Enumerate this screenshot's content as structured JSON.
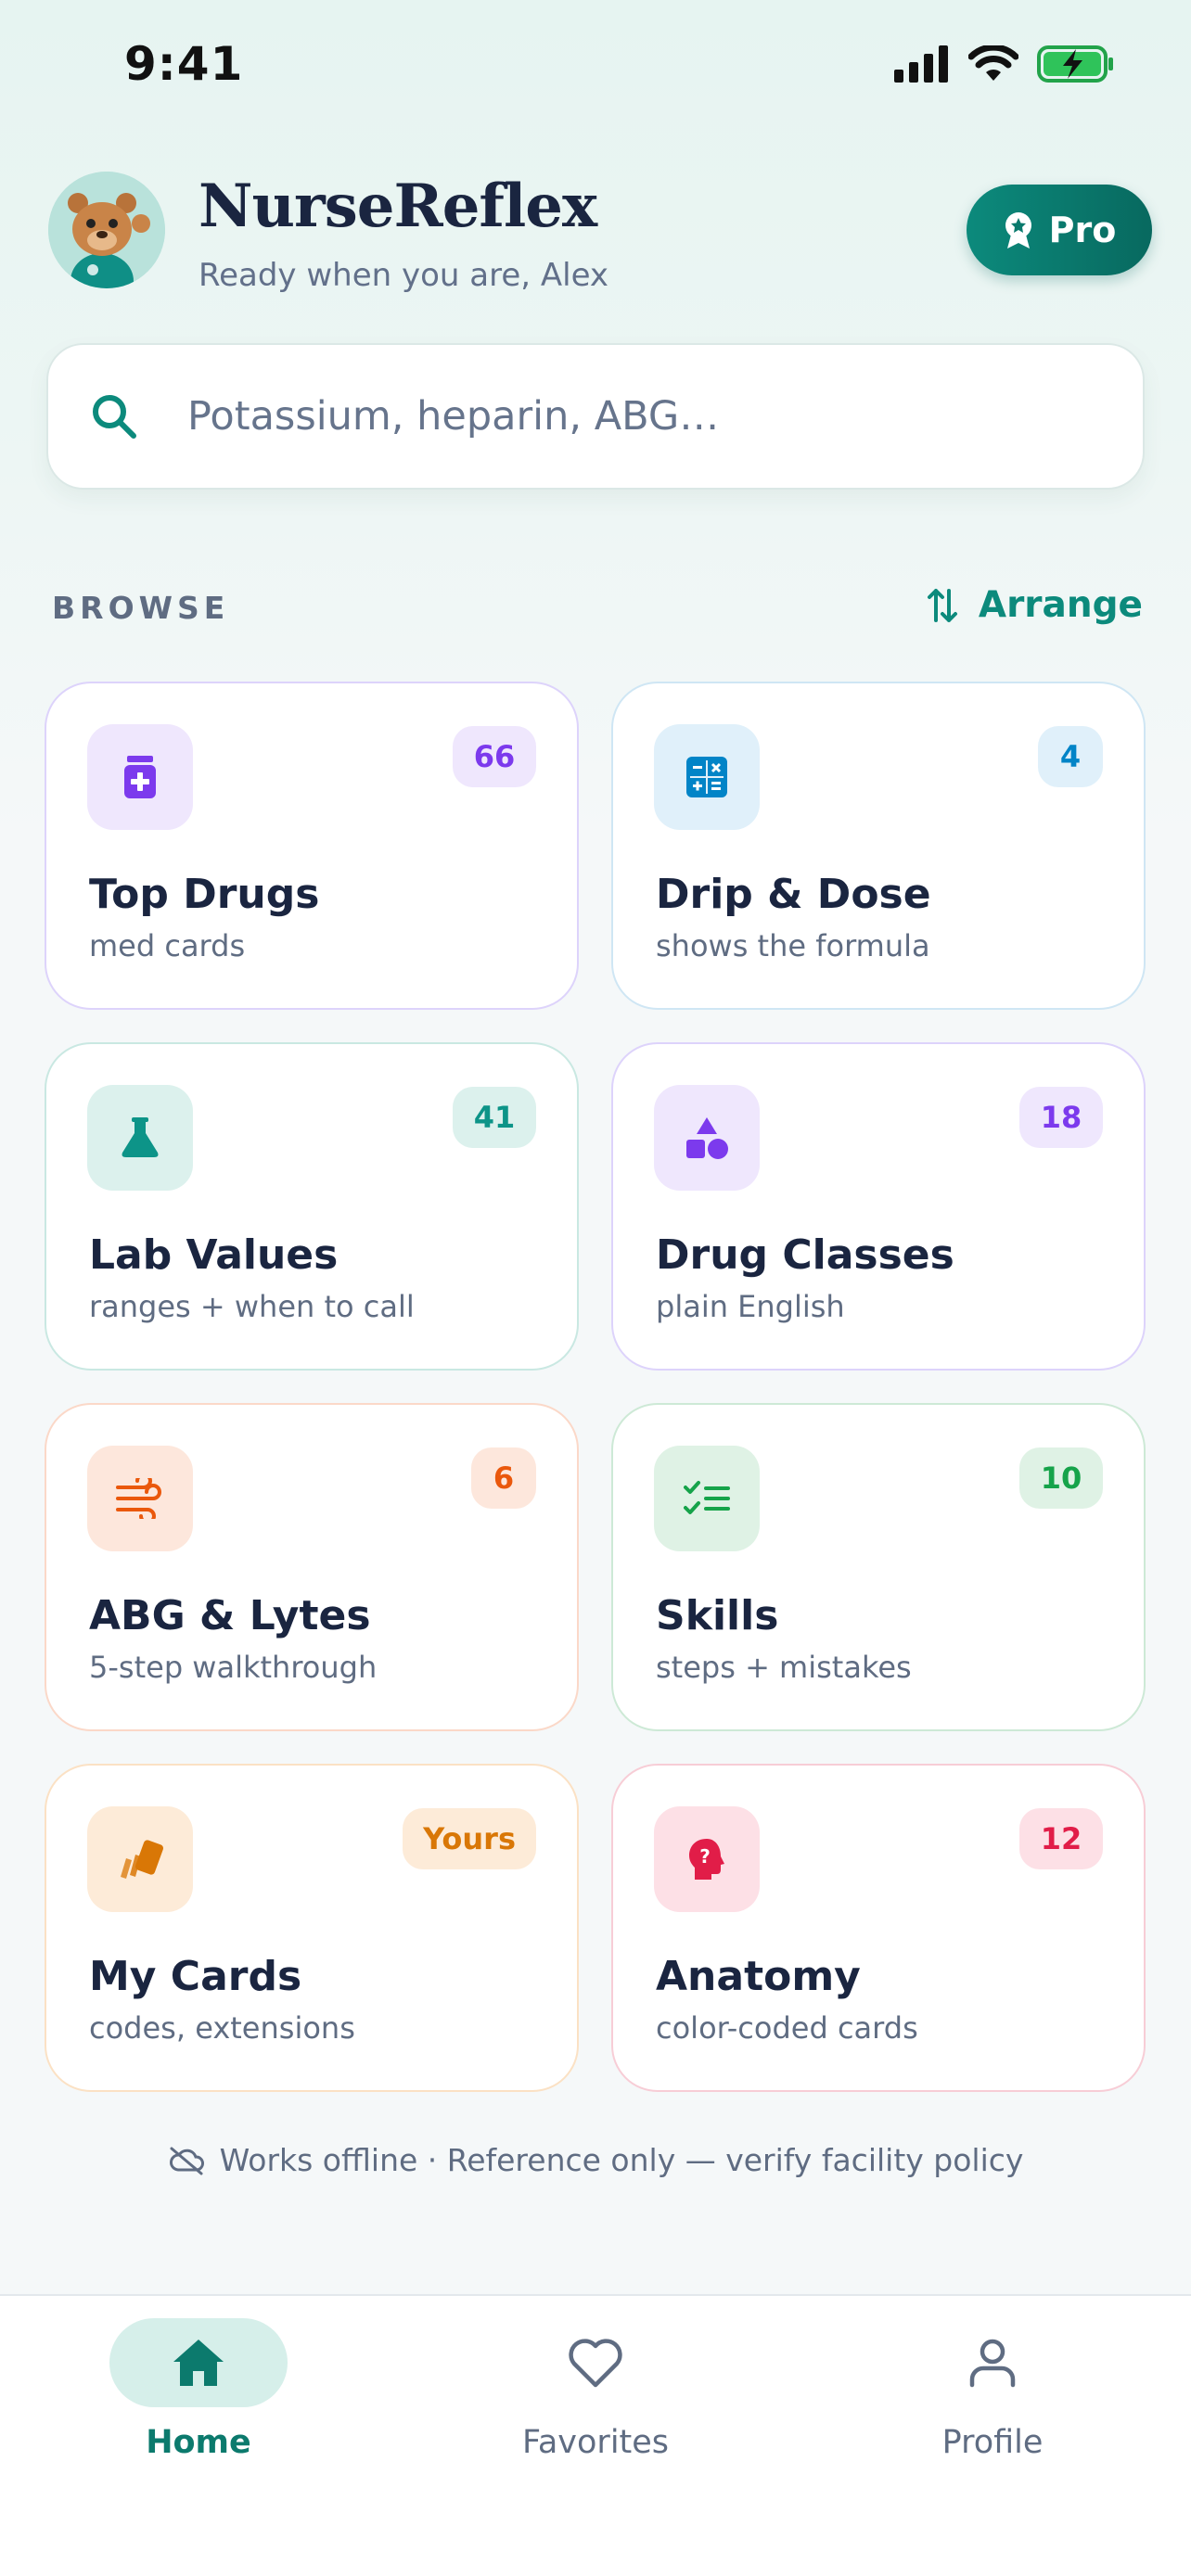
{
  "status_bar": {
    "time": "9:41"
  },
  "header": {
    "app_name": "NurseReflex",
    "subtitle": "Ready when you are, Alex",
    "pro_label": "Pro"
  },
  "search": {
    "placeholder": "Potassium, heparin, ABG…"
  },
  "browse": {
    "label": "BROWSE",
    "arrange_label": "Arrange"
  },
  "categories": [
    {
      "title": "Top Drugs",
      "subtitle": "med cards",
      "badge": "66",
      "icon": "pill-bottle-icon",
      "accent": "#7c3aed"
    },
    {
      "title": "Drip & Dose",
      "subtitle": "shows the formula",
      "badge": "4",
      "icon": "calculator-icon",
      "accent": "#0284c7"
    },
    {
      "title": "Lab Values",
      "subtitle": "ranges + when to call",
      "badge": "41",
      "icon": "flask-icon",
      "accent": "#0d9488"
    },
    {
      "title": "Drug Classes",
      "subtitle": "plain English",
      "badge": "18",
      "icon": "shapes-icon",
      "accent": "#7c3aed"
    },
    {
      "title": "ABG & Lytes",
      "subtitle": "5-step walkthrough",
      "badge": "6",
      "icon": "wind-icon",
      "accent": "#ea580c"
    },
    {
      "title": "Skills",
      "subtitle": "steps + mistakes",
      "badge": "10",
      "icon": "checklist-icon",
      "accent": "#16a34a"
    },
    {
      "title": "My Cards",
      "subtitle": "codes, extensions",
      "badge": "Yours",
      "icon": "cards-icon",
      "accent": "#d97706"
    },
    {
      "title": "Anatomy",
      "subtitle": "color-coded cards",
      "badge": "12",
      "icon": "head-icon",
      "accent": "#e11d48"
    }
  ],
  "footer_note": "Works offline · Reference only — verify facility policy",
  "tabs": [
    {
      "label": "Home",
      "active": true
    },
    {
      "label": "Favorites",
      "active": false
    },
    {
      "label": "Profile",
      "active": false
    }
  ],
  "colors": {
    "brand": "#0c8a7c",
    "text": "#1a2540",
    "muted": "#5f6c82"
  }
}
